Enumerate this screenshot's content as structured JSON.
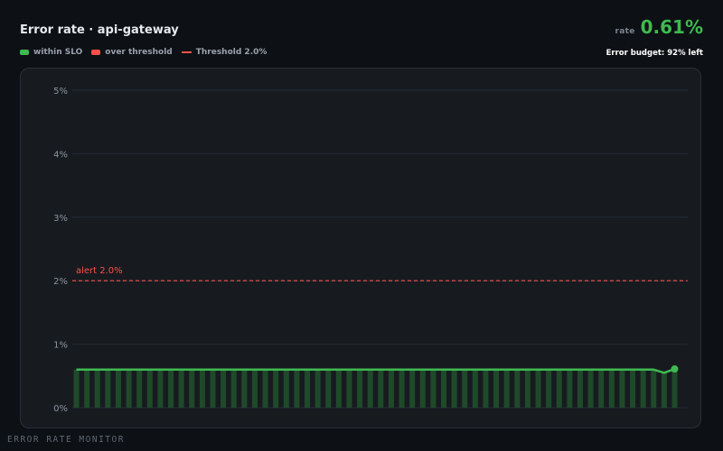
{
  "header": {
    "title": "Error rate · api-gateway",
    "rate_label": "rate",
    "rate_value": "0.61%",
    "budget": "Error budget: 92% left"
  },
  "legend": {
    "within": "within SLO",
    "over": "over threshold",
    "threshold": "Threshold 2.0%"
  },
  "footer": "ERROR RATE MONITOR",
  "colors": {
    "within": "#3fb950",
    "within_bar": "#1f4a2a",
    "over": "#f85149",
    "threshold": "#f85149"
  },
  "chart_data": {
    "type": "bar",
    "ylim": [
      0,
      5
    ],
    "yticks": [
      "0%",
      "1%",
      "2%",
      "3%",
      "4%",
      "5%"
    ],
    "threshold": 2.0,
    "threshold_label": "alert 2.0%",
    "grid": true,
    "legend_placement": "top-left",
    "values": [
      0.6,
      0.6,
      0.6,
      0.6,
      0.6,
      0.6,
      0.6,
      0.6,
      0.6,
      0.6,
      0.6,
      0.6,
      0.6,
      0.6,
      0.6,
      0.6,
      0.6,
      0.6,
      0.6,
      0.6,
      0.6,
      0.6,
      0.6,
      0.6,
      0.6,
      0.6,
      0.6,
      0.6,
      0.6,
      0.6,
      0.6,
      0.6,
      0.6,
      0.6,
      0.6,
      0.6,
      0.6,
      0.6,
      0.6,
      0.6,
      0.6,
      0.6,
      0.6,
      0.6,
      0.6,
      0.6,
      0.6,
      0.6,
      0.6,
      0.6,
      0.6,
      0.6,
      0.6,
      0.6,
      0.6,
      0.6,
      0.55,
      0.61
    ]
  }
}
